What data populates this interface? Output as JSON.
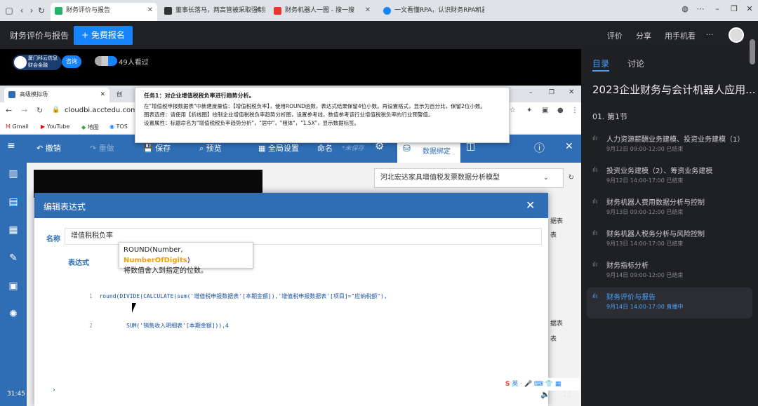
{
  "browser": {
    "tabs": [
      {
        "label": "财务评价与报告",
        "active": true
      },
      {
        "label": "董事长落马，两高管被采取强制措施"
      },
      {
        "label": "财务机器人一图 - 搜一搜"
      },
      {
        "label": "一文看懂RPA，认识财务RPA机器人"
      }
    ]
  },
  "course": {
    "title": "财务评价与报告",
    "signup_label": "+ 免费报名",
    "links": [
      "评价",
      "分享",
      "用手机看",
      "···"
    ]
  },
  "live": {
    "org": "厦门科云信息",
    "org_sub": "财会金融",
    "consult": "咨询",
    "viewers": "49人看过"
  },
  "inner": {
    "tabs": [
      "高级模拟场",
      "创"
    ],
    "url": "cloudbi.acctedu.com/c",
    "bookmarks": [
      "Gmail",
      "YouTube",
      "地图",
      "TOS"
    ],
    "toolbar": {
      "undo": "撤销",
      "redo": "重做",
      "save": "保存",
      "preview": "预览",
      "global": "全局设置",
      "rename": "命名",
      "unsaved": "*未保存",
      "data_bind": "数据绑定"
    },
    "dropdown": "河北宏达家具增值税发票数据分析模型",
    "side_text": [
      "据表",
      "表",
      "据表",
      "表"
    ]
  },
  "task": {
    "heading": "任务1：对企业增值税税负率进行趋势分析。",
    "lines": [
      "在\"增值税申报数据表\"中新建度量值：【增值税税负率】，使用ROUND函数，表达式结果保留4位小数。再设置格式，显示为百分比，保留2位小数。",
      "图表选择：请使用【折线图】绘制企业增值税税负率趋势分析图，设置参考线，数值参考该行业增值税税负率的行业预警值。",
      "设置属性：标题命名为\"增值税税负率趋势分析\"，\"居中\"，\"粗体\"，\"1.5X\"，显示数据标签。"
    ]
  },
  "dialog": {
    "title": "编辑表达式",
    "name_label": "名称",
    "name_value": "增值税税负率",
    "expr_label": "表达式",
    "tooltip_sig_a": "ROUND(Number, ",
    "tooltip_sig_b": "NumberOfDigits",
    "tooltip_sig_c": ")",
    "tooltip_desc": "将数值舍入到指定的位数。",
    "code_line1": "round(DIVIDE(CALCULATE(sum('增值税申报数据表'[本期金额]),'增值税申报数据表'[项目]=\"应纳税额\"),",
    "code_line2": "        SUM('销售收入明细表'[本期金额])),4"
  },
  "player": {
    "time": "31:45"
  },
  "ime": "英 · 🎤 ⌨ 👕 ▦",
  "right_panel": {
    "tabs": [
      "目录",
      "讨论"
    ],
    "session_title": "2023企业财务与会计机器人应用...",
    "section": "01. 第1节",
    "items": [
      {
        "title": "人力资源薪酬业务建模、投资业务建模（1）",
        "sub": "9月12日 09:00-12:00 已结束"
      },
      {
        "title": "投资业务建模（2）、筹资业务建模",
        "sub": "9月12日 14:00-17:00 已结束"
      },
      {
        "title": "财务机器人费用数据分析与控制",
        "sub": "9月13日 09:00-12:00 已结束"
      },
      {
        "title": "财务机器人税务分析与风险控制",
        "sub": "9月13日 14:00-17:00 已结束"
      },
      {
        "title": "财务指标分析",
        "sub": "9月14日 09:00-12:00 已结束"
      },
      {
        "title": "财务评价与报告",
        "sub": "9月14日 14:00-17:00 直播中",
        "active": true
      }
    ]
  }
}
